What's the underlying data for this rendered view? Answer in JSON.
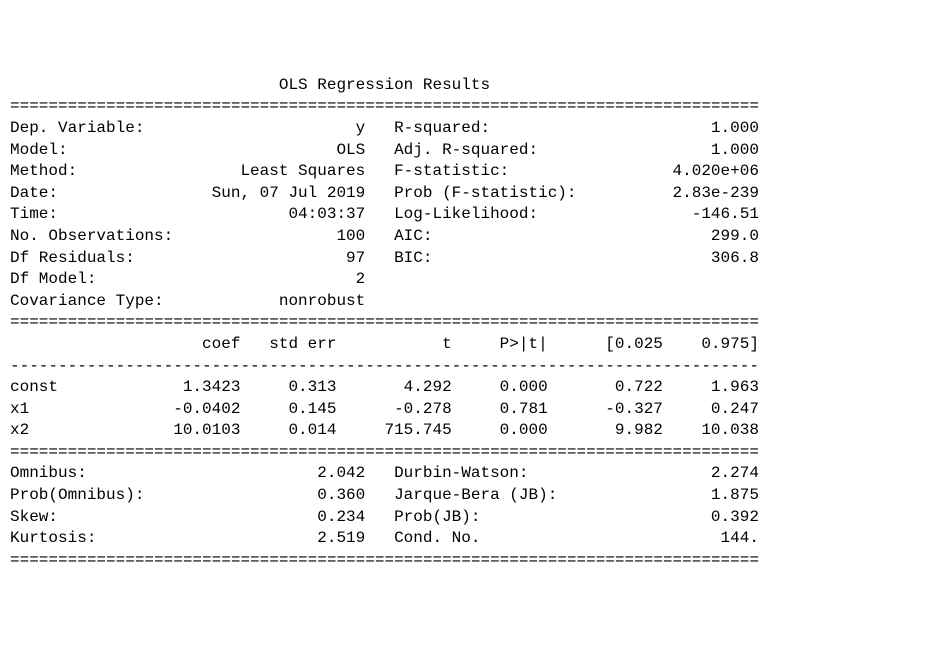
{
  "title": "OLS Regression Results",
  "width": 78,
  "header": {
    "left": [
      {
        "label": "Dep. Variable:",
        "value": "y"
      },
      {
        "label": "Model:",
        "value": "OLS"
      },
      {
        "label": "Method:",
        "value": "Least Squares"
      },
      {
        "label": "Date:",
        "value": "Sun, 07 Jul 2019"
      },
      {
        "label": "Time:",
        "value": "04:03:37"
      },
      {
        "label": "No. Observations:",
        "value": "100"
      },
      {
        "label": "Df Residuals:",
        "value": "97"
      },
      {
        "label": "Df Model:",
        "value": "2"
      },
      {
        "label": "Covariance Type:",
        "value": "nonrobust"
      }
    ],
    "right": [
      {
        "label": "R-squared:",
        "value": "1.000"
      },
      {
        "label": "Adj. R-squared:",
        "value": "1.000"
      },
      {
        "label": "F-statistic:",
        "value": "4.020e+06"
      },
      {
        "label": "Prob (F-statistic):",
        "value": "2.83e-239"
      },
      {
        "label": "Log-Likelihood:",
        "value": "-146.51"
      },
      {
        "label": "AIC:",
        "value": "299.0"
      },
      {
        "label": "BIC:",
        "value": "306.8"
      }
    ]
  },
  "coef_table": {
    "columns": [
      "",
      "coef",
      "std err",
      "t",
      "P>|t|",
      "[0.025",
      "0.975]"
    ],
    "rows": [
      {
        "name": "const",
        "coef": "1.3423",
        "stderr": "0.313",
        "t": "4.292",
        "p": "0.000",
        "lo": "0.722",
        "hi": "1.963"
      },
      {
        "name": "x1",
        "coef": "-0.0402",
        "stderr": "0.145",
        "t": "-0.278",
        "p": "0.781",
        "lo": "-0.327",
        "hi": "0.247"
      },
      {
        "name": "x2",
        "coef": "10.0103",
        "stderr": "0.014",
        "t": "715.745",
        "p": "0.000",
        "lo": "9.982",
        "hi": "10.038"
      }
    ]
  },
  "diagnostics": {
    "left": [
      {
        "label": "Omnibus:",
        "value": "2.042"
      },
      {
        "label": "Prob(Omnibus):",
        "value": "0.360"
      },
      {
        "label": "Skew:",
        "value": "0.234"
      },
      {
        "label": "Kurtosis:",
        "value": "2.519"
      }
    ],
    "right": [
      {
        "label": "Durbin-Watson:",
        "value": "2.274"
      },
      {
        "label": "Jarque-Bera (JB):",
        "value": "1.875"
      },
      {
        "label": "Prob(JB):",
        "value": "0.392"
      },
      {
        "label": "Cond. No.",
        "value": "144."
      }
    ]
  }
}
